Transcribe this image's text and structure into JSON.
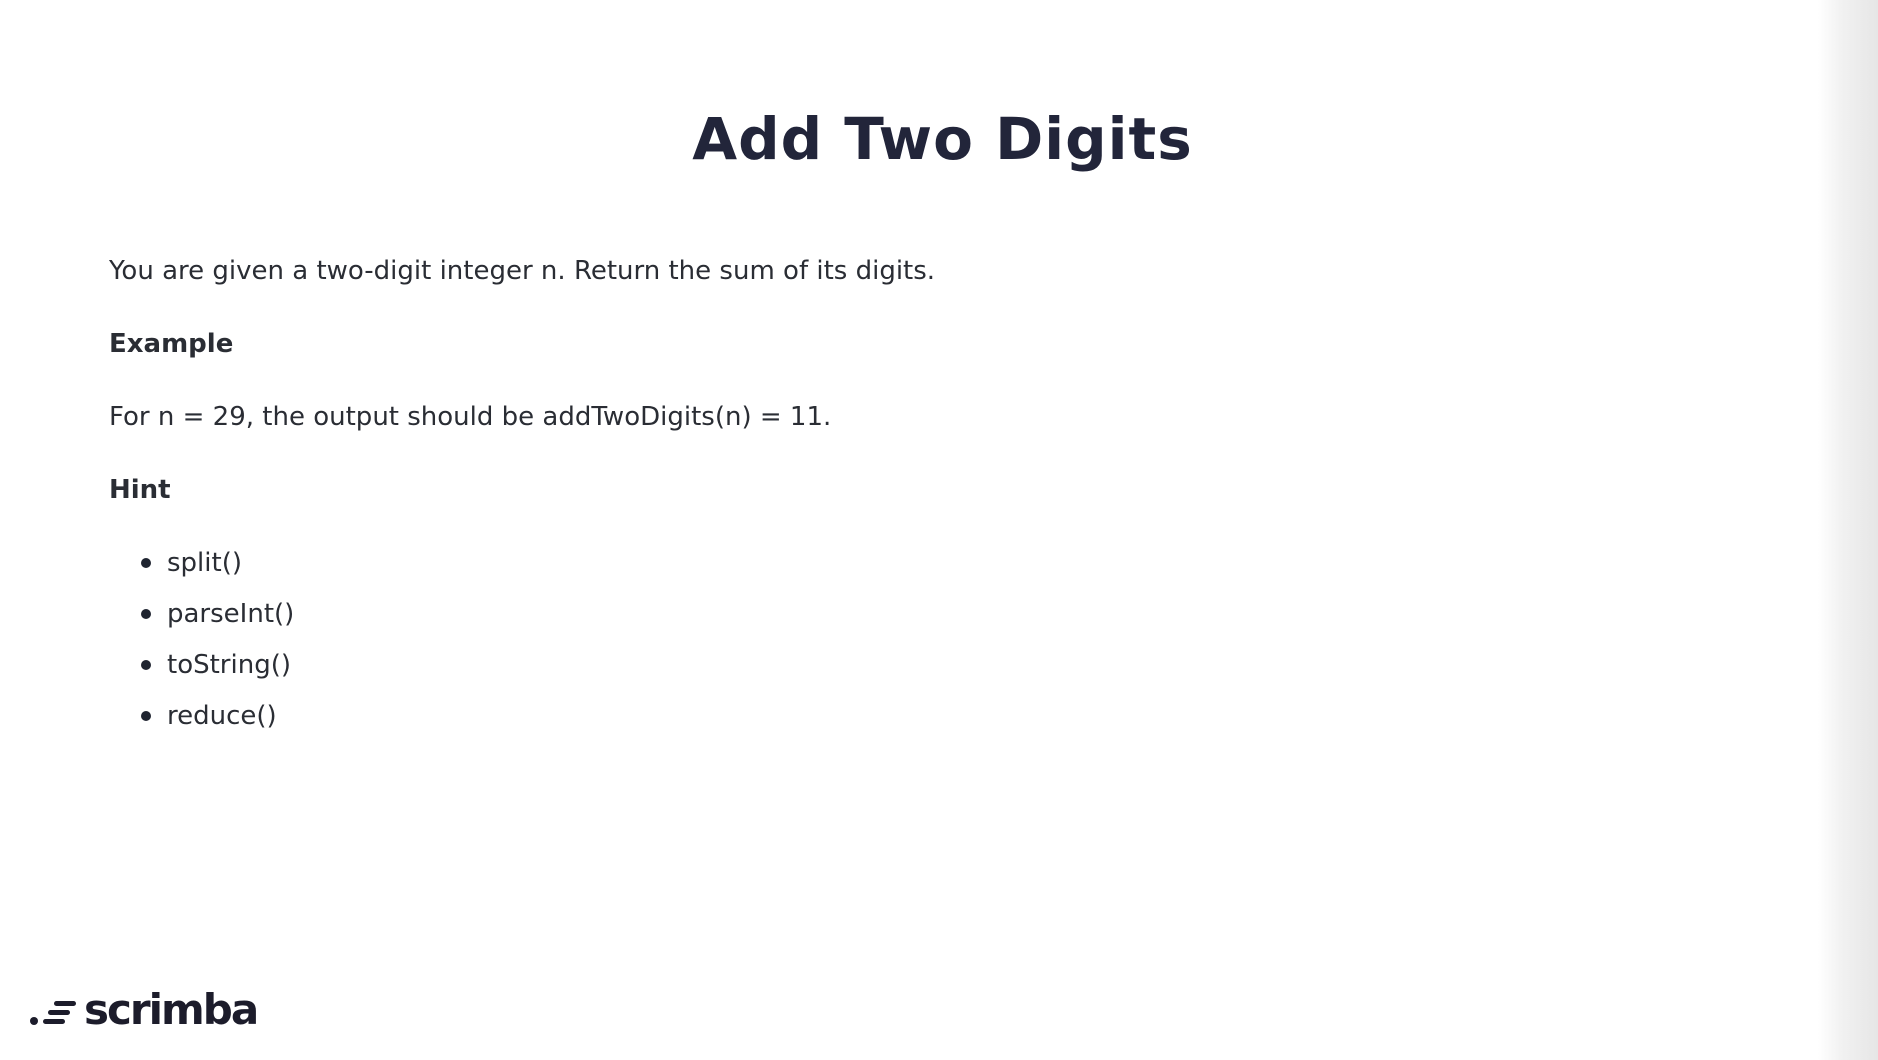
{
  "slide": {
    "title": "Add Two Digits",
    "description": "You are given a two-digit integer n. Return the sum of its digits.",
    "example_heading": "Example",
    "example_text": "For n = 29, the output should be addTwoDigits(n) = 11.",
    "hint_heading": "Hint",
    "hints": [
      "split()",
      "parseInt()",
      "toString()",
      "reduce()"
    ]
  },
  "brand": {
    "logo_text": "scrimba",
    "icon": "scrimba-logo-icon"
  }
}
